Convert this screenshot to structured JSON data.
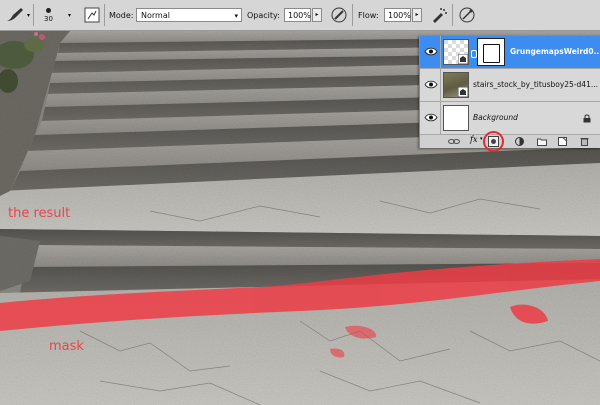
{
  "options_bar": {
    "brush_size": "30",
    "mode_label": "Mode:",
    "mode_value": "Normal",
    "opacity_label": "Opacity:",
    "opacity_value": "100%",
    "flow_label": "Flow:",
    "flow_value": "100%"
  },
  "layers": [
    {
      "name": "GrungemapsWeird0...",
      "selected": true
    },
    {
      "name": "stairs_stock_by_titusboy25-d41...",
      "selected": false
    },
    {
      "name": "Background",
      "selected": false
    }
  ],
  "annotations": {
    "result": "the result",
    "mask": "mask"
  },
  "colors": {
    "highlight_stroke": "#ee3c46",
    "selected_layer": "#3d8cf0",
    "annotation": "#e8444b"
  }
}
